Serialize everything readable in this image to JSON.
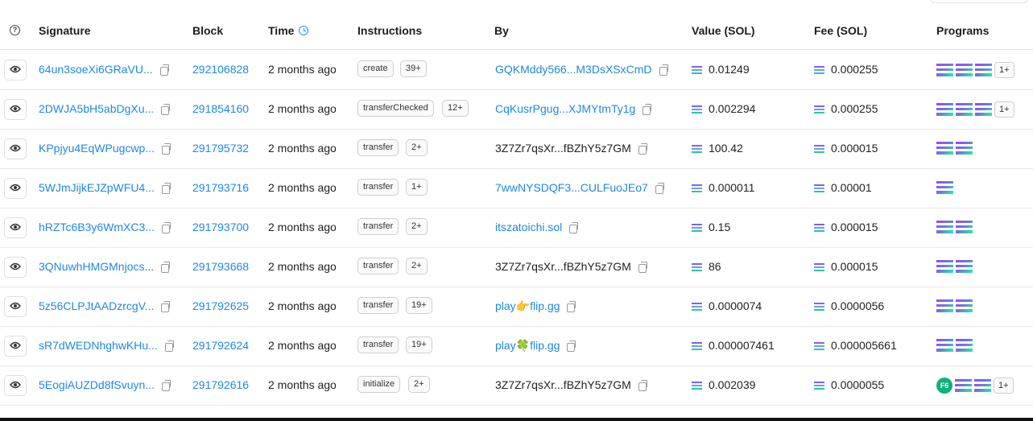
{
  "header": {
    "signature": "Signature",
    "block": "Block",
    "time": "Time",
    "instructions": "Instructions",
    "by": "By",
    "value": "Value (SOL)",
    "fee": "Fee (SOL)",
    "programs": "Programs"
  },
  "rows": [
    {
      "sig": "64un3soeXi6GRaVU...",
      "block": "292106828",
      "time": "2 months ago",
      "instr": "create",
      "count": "39+",
      "by": "GQKMddy566...M3DsXSxCmD",
      "by_link": true,
      "value": "0.01249",
      "fee": "0.000255",
      "programs": [
        "sol",
        "sol",
        "sol"
      ],
      "more": "1+"
    },
    {
      "sig": "2DWJA5bH5abDgXu...",
      "block": "291854160",
      "time": "2 months ago",
      "instr": "transferChecked",
      "count": "12+",
      "by": "CqKusrPgug...XJMYtmTy1g",
      "by_link": true,
      "value": "0.002294",
      "fee": "0.000255",
      "programs": [
        "sol",
        "sol",
        "sol"
      ],
      "more": "1+"
    },
    {
      "sig": "KPpjyu4EqWPugcwp...",
      "block": "291795732",
      "time": "2 months ago",
      "instr": "transfer",
      "count": "2+",
      "by": "3Z7Zr7qsXr...fBZhY5z7GM",
      "by_link": false,
      "value": "100.42",
      "fee": "0.000015",
      "programs": [
        "sol",
        "sol"
      ],
      "more": ""
    },
    {
      "sig": "5WJmJijkEJZpWFU4...",
      "block": "291793716",
      "time": "2 months ago",
      "instr": "transfer",
      "count": "1+",
      "by": "7wwNYSDQF3...CULFuoJEo7",
      "by_link": true,
      "value": "0.000011",
      "fee": "0.00001",
      "programs": [
        "sol"
      ],
      "more": ""
    },
    {
      "sig": "hRZTc6B3y6WmXC3...",
      "block": "291793700",
      "time": "2 months ago",
      "instr": "transfer",
      "count": "2+",
      "by": "itszatoichi.sol",
      "by_link": true,
      "value": "0.15",
      "fee": "0.000015",
      "programs": [
        "sol",
        "sol"
      ],
      "more": ""
    },
    {
      "sig": "3QNuwhHMGMnjocs...",
      "block": "291793668",
      "time": "2 months ago",
      "instr": "transfer",
      "count": "2+",
      "by": "3Z7Zr7qsXr...fBZhY5z7GM",
      "by_link": false,
      "value": "86",
      "fee": "0.000015",
      "programs": [
        "sol",
        "sol"
      ],
      "more": ""
    },
    {
      "sig": "5z56CLPJtAADzrcgV...",
      "block": "291792625",
      "time": "2 months ago",
      "instr": "transfer",
      "count": "19+",
      "by": "play👉flip.gg",
      "by_link": true,
      "value": "0.0000074",
      "fee": "0.0000056",
      "programs": [
        "sol",
        "sol"
      ],
      "more": ""
    },
    {
      "sig": "sR7dWEDNhghwKHu...",
      "block": "291792624",
      "time": "2 months ago",
      "instr": "transfer",
      "count": "19+",
      "by": "play🍀flip.gg",
      "by_link": true,
      "value": "0.000007461",
      "fee": "0.000005661",
      "programs": [
        "sol",
        "sol"
      ],
      "more": ""
    },
    {
      "sig": "5EogiAUZDd8fSvuyn...",
      "block": "291792616",
      "time": "2 months ago",
      "instr": "initialize",
      "count": "2+",
      "by": "3Z7Zr7qsXr...fBZhY5z7GM",
      "by_link": false,
      "value": "0.002039",
      "fee": "0.0000055",
      "programs": [
        "f6",
        "sol",
        "sol"
      ],
      "f6_label": "F6",
      "more": "1+"
    }
  ],
  "colors": {
    "link": "#1e88e5",
    "border": "#e8e8e8"
  }
}
